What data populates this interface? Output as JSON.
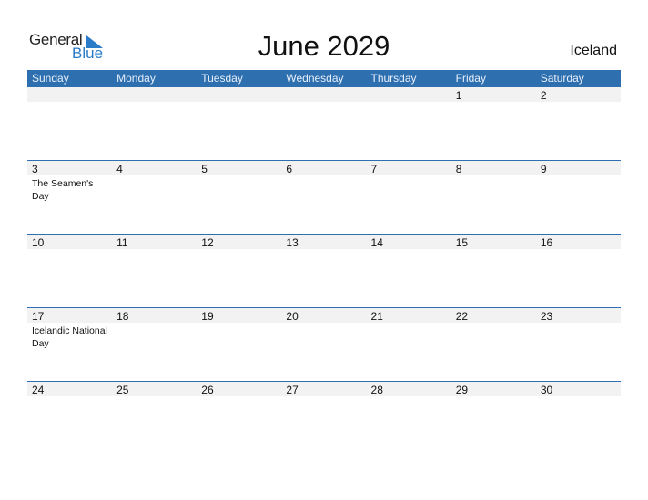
{
  "logo": {
    "word1": "General",
    "word2": "Blue"
  },
  "title": "June 2029",
  "country": "Iceland",
  "weekdays": [
    "Sunday",
    "Monday",
    "Tuesday",
    "Wednesday",
    "Thursday",
    "Friday",
    "Saturday"
  ],
  "weeks": [
    [
      {
        "day": "",
        "event": ""
      },
      {
        "day": "",
        "event": ""
      },
      {
        "day": "",
        "event": ""
      },
      {
        "day": "",
        "event": ""
      },
      {
        "day": "",
        "event": ""
      },
      {
        "day": "1",
        "event": ""
      },
      {
        "day": "2",
        "event": ""
      }
    ],
    [
      {
        "day": "3",
        "event": "The Seamen's Day"
      },
      {
        "day": "4",
        "event": ""
      },
      {
        "day": "5",
        "event": ""
      },
      {
        "day": "6",
        "event": ""
      },
      {
        "day": "7",
        "event": ""
      },
      {
        "day": "8",
        "event": ""
      },
      {
        "day": "9",
        "event": ""
      }
    ],
    [
      {
        "day": "10",
        "event": ""
      },
      {
        "day": "11",
        "event": ""
      },
      {
        "day": "12",
        "event": ""
      },
      {
        "day": "13",
        "event": ""
      },
      {
        "day": "14",
        "event": ""
      },
      {
        "day": "15",
        "event": ""
      },
      {
        "day": "16",
        "event": ""
      }
    ],
    [
      {
        "day": "17",
        "event": "Icelandic National Day"
      },
      {
        "day": "18",
        "event": ""
      },
      {
        "day": "19",
        "event": ""
      },
      {
        "day": "20",
        "event": ""
      },
      {
        "day": "21",
        "event": ""
      },
      {
        "day": "22",
        "event": ""
      },
      {
        "day": "23",
        "event": ""
      }
    ],
    [
      {
        "day": "24",
        "event": ""
      },
      {
        "day": "25",
        "event": ""
      },
      {
        "day": "26",
        "event": ""
      },
      {
        "day": "27",
        "event": ""
      },
      {
        "day": "28",
        "event": ""
      },
      {
        "day": "29",
        "event": ""
      },
      {
        "day": "30",
        "event": ""
      }
    ]
  ]
}
